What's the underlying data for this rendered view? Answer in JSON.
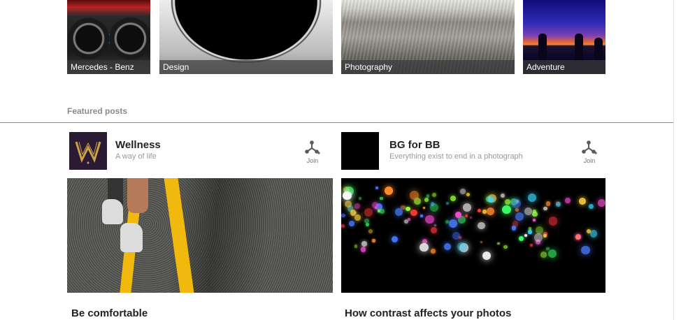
{
  "collections": [
    {
      "label": "Mercedes - Benz"
    },
    {
      "label": "Design"
    },
    {
      "label": "Photography"
    },
    {
      "label": "Adventure"
    }
  ],
  "featured": {
    "section_title": "Featured posts",
    "posts": [
      {
        "author": "Wellness",
        "tagline": "A way of life",
        "join_label": "Join",
        "title": "Be comfortable"
      },
      {
        "author": "BG for BB",
        "tagline": "Everything exist to end in a photograph",
        "join_label": "Join",
        "title": "How contrast affects your photos"
      }
    ]
  },
  "colors": {
    "divider": "#4a9fc2",
    "road_line": "#f1b80e",
    "tile_label_bg": "rgba(60,60,60,0.72)"
  },
  "icons": {
    "join": "join-network-icon"
  }
}
